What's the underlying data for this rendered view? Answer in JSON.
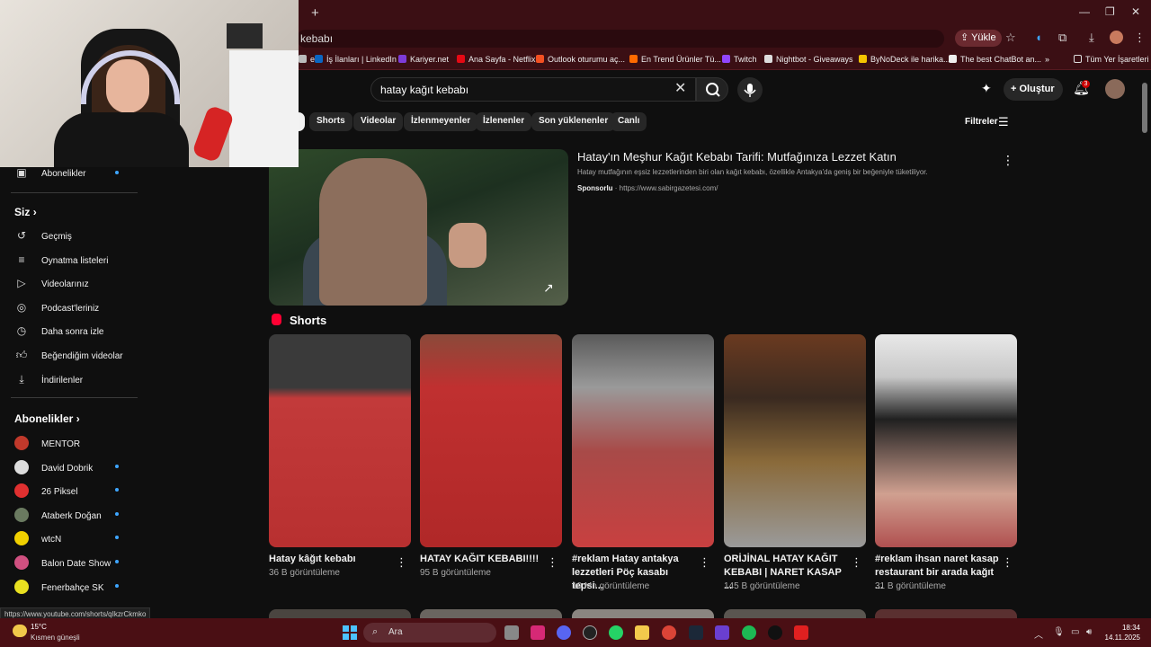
{
  "browser": {
    "address": "kebabı",
    "upload_label": "Yükle",
    "bookmarks": [
      {
        "label": "e",
        "color": "#bbbbbb"
      },
      {
        "label": "İş İlanları | LinkedIn",
        "color": "#0a66c2"
      },
      {
        "label": "Kariyer.net",
        "color": "#7d3bd8"
      },
      {
        "label": "Ana Sayfa - Netflix",
        "color": "#e50914"
      },
      {
        "label": "Outlook oturumu aç...",
        "color": "#f25022"
      },
      {
        "label": "En Trend Ürünler Tü...",
        "color": "#ff6a00"
      },
      {
        "label": "Twitch",
        "color": "#9146ff"
      },
      {
        "label": "Nightbot - Giveaways",
        "color": "#dddddd"
      },
      {
        "label": "ByNoDeck ile harika...",
        "color": "#f5c400"
      },
      {
        "label": "The best ChatBot an...",
        "color": "#eeeeee"
      }
    ],
    "more_bookmarks": "»",
    "all_bookmarks": "Tüm Yer İşaretleri"
  },
  "header": {
    "search_value": "hatay kağıt kebabı",
    "create_label": "Oluştur",
    "notif_count": "3"
  },
  "chips": [
    "Shorts",
    "Videolar",
    "İzlenmeyenler",
    "İzlenenler",
    "Son yüklenenler",
    "Canlı"
  ],
  "filters_label": "Filtreler",
  "sidebar": {
    "subscriptions_item": "Abonelikler",
    "you_heading": "Siz",
    "you_items": [
      "Geçmiş",
      "Oynatma listeleri",
      "Videolarınız",
      "Podcast'leriniz",
      "Daha sonra izle",
      "Beğendiğim videolar",
      "İndirilenler"
    ],
    "subs_heading": "Abonelikler",
    "channels": [
      {
        "name": "MENTOR",
        "dot": false,
        "color": "#c0392b"
      },
      {
        "name": "David Dobrik",
        "dot": true,
        "color": "#dddddd"
      },
      {
        "name": "26 Piksel",
        "dot": true,
        "color": "#e03030"
      },
      {
        "name": "Ataberk Doğan",
        "dot": true,
        "color": "#6a7a60"
      },
      {
        "name": "wtcN",
        "dot": true,
        "color": "#f0d000"
      },
      {
        "name": "Balon Date Show",
        "dot": true,
        "color": "#d05080"
      },
      {
        "name": "Fenerbahçe SK",
        "dot": true,
        "color": "#e8e020"
      }
    ]
  },
  "ad": {
    "title": "Hatay'ın Meşhur Kağıt Kebabı Tarifi: Mutfağınıza Lezzet Katın",
    "description": "Hatay mutfağının eşsiz lezzetlerinden biri olan kağıt kebabı, özellikle Antakya'da geniş bir beğeniyle tüketiliyor.",
    "sponsored": "Sponsorlu",
    "url": "https://www.sabirgazetesi.com/"
  },
  "shorts_heading": "Shorts",
  "shorts": [
    {
      "title": "Hatay kâğıt kebabı",
      "views": "36 B görüntüleme"
    },
    {
      "title": "HATAY KAĞIT KEBABI!!!!",
      "views": "95 B görüntüleme"
    },
    {
      "title": "#reklam Hatay antakya lezzetleri Pöç kasabı tepsi...",
      "views": "10 Mn görüntüleme"
    },
    {
      "title": "ORİJİNAL HATAY KAĞIT KEBABI | NARET KASAP ...",
      "views": "145 B görüntüleme"
    },
    {
      "title": "#reklam ihsan naret kasap restaurant bir arada kağıt ...",
      "views": "31 B görüntüleme"
    }
  ],
  "status_url": "https://www.youtube.com/shorts/qIkzrCkmko",
  "taskbar": {
    "temp": "15°C",
    "condition": "Kısmen güneşli",
    "search": "Ara",
    "time": "18:34",
    "date": "14.11.2025"
  }
}
